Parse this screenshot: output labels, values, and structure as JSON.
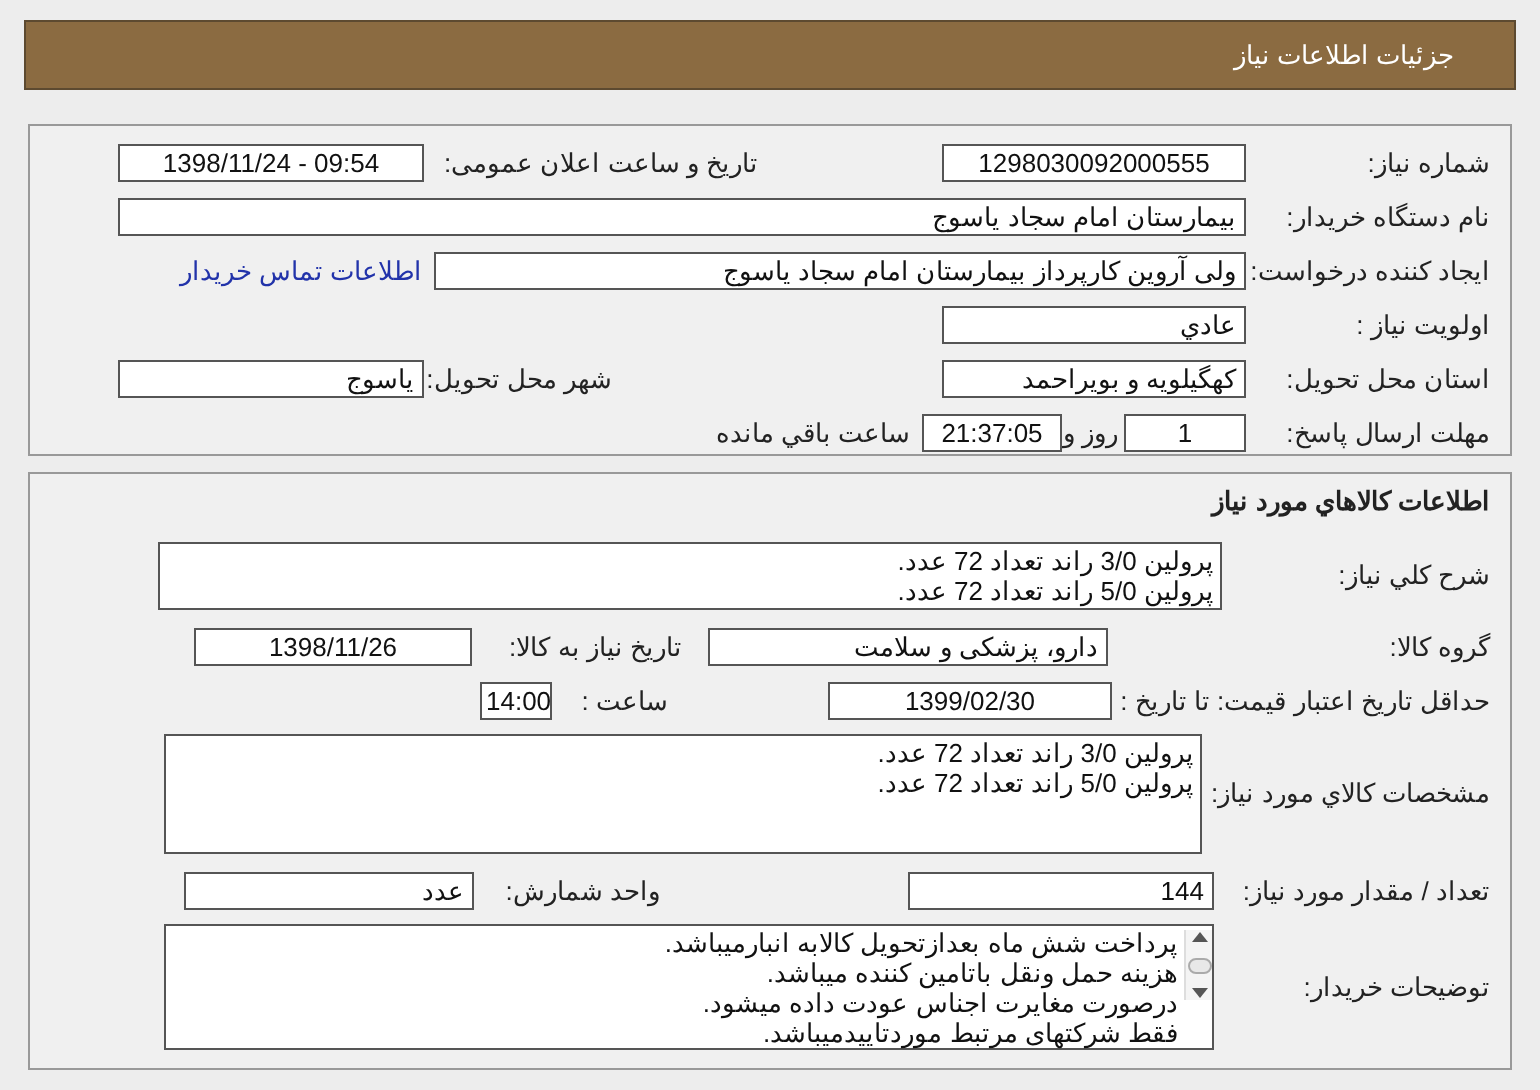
{
  "header": {
    "title": "جزئیات اطلاعات نیاز"
  },
  "general": {
    "need_number": {
      "label": "شماره نیاز:",
      "value": "1298030092000555"
    },
    "announce": {
      "label": "تاریخ و ساعت اعلان عمومی:",
      "value": "1398/11/24 - 09:54"
    },
    "buyer_org": {
      "label": "نام دستگاه خریدار:",
      "value": "بیمارستان امام سجاد یاسوج"
    },
    "creator": {
      "label": "ایجاد کننده درخواست:",
      "value": "ولی آروین کارپرداز بیمارستان امام سجاد یاسوج",
      "link": "اطلاعات تماس خریدار"
    },
    "priority": {
      "label": "اولویت نیاز :",
      "value": "عادي"
    },
    "province": {
      "label": "استان محل تحویل:",
      "value": "کهگیلویه و بویراحمد"
    },
    "city": {
      "label": "شهر محل تحویل:",
      "value": "یاسوج"
    },
    "deadline": {
      "label": "مهلت ارسال پاسخ:",
      "days": "1",
      "days_unit": "روز و",
      "time": "21:37:05",
      "remaining": "ساعت باقي مانده"
    }
  },
  "goods": {
    "title": "اطلاعات کالاهاي مورد نیاز",
    "summary": {
      "label": "شرح کلي نیاز:",
      "lines": [
        "پرولین 3/0 راند تعداد 72 عدد.",
        "پرولین 5/0 راند تعداد 72 عدد."
      ]
    },
    "group": {
      "label": "گروه کالا:",
      "value": "دارو، پزشکی و سلامت"
    },
    "need_date": {
      "label": "تاریخ نیاز به کالا:",
      "value": "1398/11/26"
    },
    "price_validity": {
      "label": "حداقل تاریخ اعتبار قیمت:",
      "to_label": "تا تاریخ :",
      "date": "1399/02/30",
      "time_label": "ساعت :",
      "time": "14:00"
    },
    "specs": {
      "label": "مشخصات کالاي مورد نیاز:",
      "lines": [
        "پرولین 3/0 راند تعداد 72 عدد.",
        "پرولین 5/0 راند تعداد 72 عدد."
      ]
    },
    "quantity": {
      "label": "تعداد / مقدار مورد نیاز:",
      "value": "144"
    },
    "unit": {
      "label": "واحد شمارش:",
      "value": "عدد"
    },
    "buyer_notes": {
      "label": "توضیحات خریدار:",
      "lines": [
        "پرداخت شش ماه بعدازتحویل کالابه انبارمیباشد.",
        "هزینه حمل ونقل باتامین کننده میباشد.",
        "درصورت مغایرت اجناس عودت داده میشود.",
        "فقط شرکتهای مرتبط موردتاییدمیباشد."
      ]
    }
  }
}
